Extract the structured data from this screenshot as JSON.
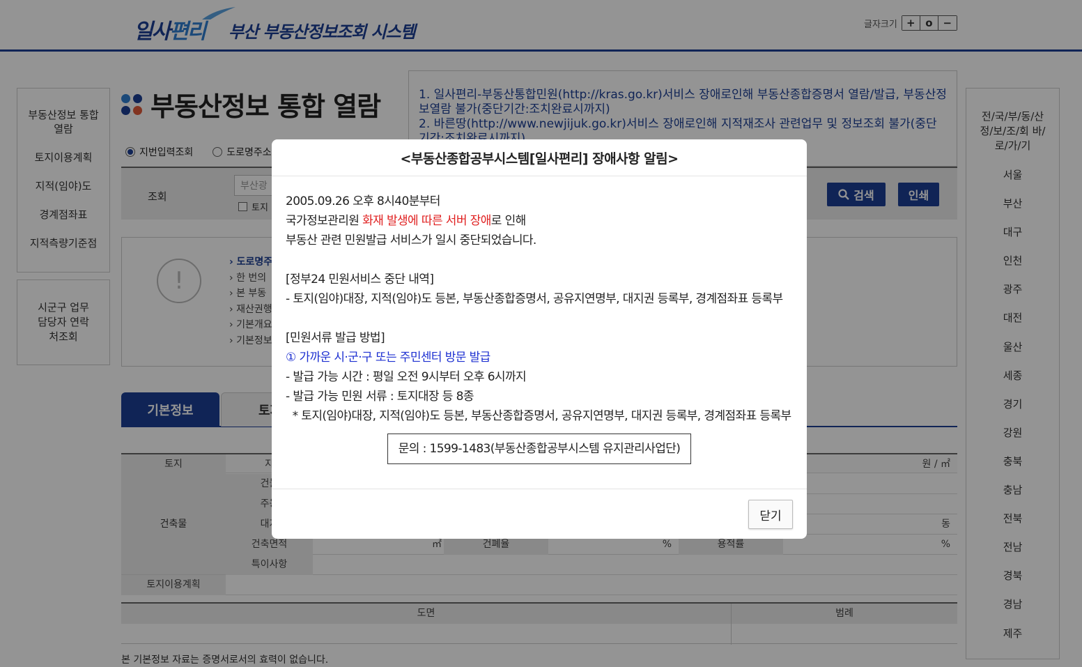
{
  "header": {
    "logo_main_1": "일사",
    "logo_main_2": "편리",
    "logo_sub": "부산 부동산정보조회 시스템",
    "fontsize_label": "글자크기",
    "fontsize_buttons": [
      "+",
      "o",
      "−"
    ]
  },
  "left_nav": {
    "items": [
      "부동산정보 통합 열람",
      "토지이용계획",
      "지적(임야)도",
      "경계점좌표",
      "지적측량기준점"
    ],
    "contact": "시군구 업무담당자 연락처조회"
  },
  "right_nav": {
    "heading": "전/국/부/동/산 정/보/조/회 바/로/가/기",
    "regions": [
      "서울",
      "부산",
      "대구",
      "인천",
      "광주",
      "대전",
      "울산",
      "세종",
      "경기",
      "강원",
      "충북",
      "충남",
      "전북",
      "전남",
      "경북",
      "경남",
      "제주"
    ]
  },
  "main": {
    "title": "부동산정보 통합 열람",
    "dot_colors": [
      "#2f7fd1",
      "#1c3f94",
      "#1c3f94",
      "#e05a3a"
    ],
    "notice": [
      "1. 일사편리-부동산통합민원(http://kras.go.kr)서비스 장애로인해 부동산종합증명서 열람/발급, 부동산정보열람 불가(중단기간:조치완료시까지)",
      "2. 바른땅(http://www.newjijuk.go.kr)서비스 장애로인해 지적재조사 관련업무 및 정보조회 불가(중단기간:조치완료시까지)"
    ],
    "radio_options": [
      "지번입력조회",
      "도로명주소"
    ],
    "search_label": "조회",
    "search_placeholder": "부산광",
    "search_checkbox": "토지",
    "search_button": "검색",
    "print_button": "인쇄",
    "info_icon": "!",
    "info_lines": [
      "도로명주",
      "한 번의",
      "본 부동",
      "재산권행",
      "기본개요",
      "기본정보"
    ],
    "tabs": [
      "기본정보",
      "토지"
    ],
    "table_labels": {
      "land": "토지",
      "land_jimok": "지",
      "unit_price": "원 / ㎡",
      "building": "건축물",
      "building_name": "건물",
      "main_use": "주용",
      "site_area": "대지",
      "unit_dong": "동",
      "floor_area": "건축면적",
      "unit_sqm": "㎡",
      "coverage": "건폐율",
      "unit_pct1": "%",
      "far": "용적률",
      "unit_pct2": "%",
      "remarks": "특이사항",
      "land_use_plan": "토지이용계획"
    },
    "table2_headers": [
      "도면",
      "범례"
    ],
    "footer_note": "본 기본정보 자료는 증명서로서의 효력이 없습니다."
  },
  "modal": {
    "title": "<부동산종합공부시스템[일사편리] 장애사항 알림>",
    "line1": "2005.09.26 오후 8시40분부터",
    "line2_pre": "국가정보관리원 ",
    "line2_red": "화재 발생에 따른 서버 장애",
    "line2_post": "로 인해",
    "line3": "부동산 관련 민원발급 서비스가 일시 중단되었습니다.",
    "section1_title": "[정부24 민원서비스 중단 내역]",
    "section1_item": " - 토지(임야)대장, 지적(임야)도 등본, 부동산종합증명서, 공유지연명부, 대지권 등록부, 경계점좌표 등록부",
    "section2_title": "[민원서류 발급 방법]",
    "section2_method": "① 가까운 시·군·구 또는 주민센터 방문 발급",
    "section2_time": " - 발급 가능 시간 : 평일 오전 9시부터 오후 6시까지",
    "section2_docs": " - 발급 가능 민원 서류 : 토지대장 등 8종",
    "section2_list": "  * 토지(임야)대장, 지적(임야)도 등본, 부동산종합증명서, 공유지연명부, 대지권 등록부, 경계점좌표 등록부",
    "contact": "문의 : 1599-1483(부동산종합공부시스템 유지관리사업단)",
    "close_button": "닫기"
  }
}
